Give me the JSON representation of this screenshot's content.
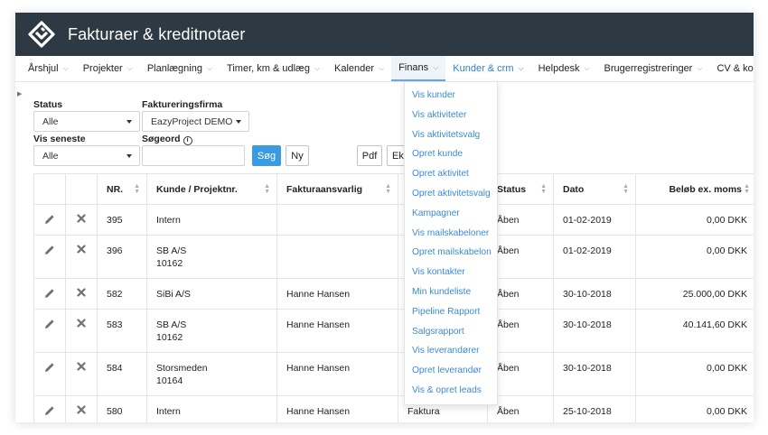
{
  "app": {
    "title": "Fakturaer & kreditnotaer"
  },
  "nav": {
    "items": [
      {
        "label": "Årshjul",
        "id": "arshjul"
      },
      {
        "label": "Projekter",
        "id": "projekter"
      },
      {
        "label": "Planlægning",
        "id": "planlaegning"
      },
      {
        "label": "Timer, km & udlæg",
        "id": "timer"
      },
      {
        "label": "Kalender",
        "id": "kalender"
      },
      {
        "label": "Finans",
        "id": "finans"
      },
      {
        "label": "Kunder & crm",
        "id": "kunder"
      },
      {
        "label": "Helpdesk",
        "id": "helpdesk"
      },
      {
        "label": "Brugerregistreringer",
        "id": "brugerregistreringer"
      },
      {
        "label": "CV & kompetencer",
        "id": "cv"
      },
      {
        "label": "K",
        "id": "k"
      }
    ],
    "active": "finans",
    "open": "kunder"
  },
  "dropdown": {
    "items": [
      "Vis kunder",
      "Vis aktiviteter",
      "Vis aktivitetsvalg",
      "Opret kunde",
      "Opret aktivitet",
      "Opret aktivitetsvalg",
      "Kampagner",
      "Vis mailskabeloner",
      "Opret mailskabelon",
      "Vis kontakter",
      "Min kundeliste",
      "Pipeline Rapport",
      "Salgsrapport",
      "Vis leverandører",
      "Opret leverandør",
      "Vis & opret leads"
    ]
  },
  "filters": {
    "status_label": "Status",
    "status_value": "Alle",
    "firm_label": "Faktureringsfirma",
    "firm_value": "EazyProject DEMO",
    "recent_label": "Vis seneste",
    "recent_value": "Alle",
    "search_label": "Søgeord",
    "search_value": "",
    "search_button": "Søg",
    "new_button": "Ny",
    "pdf_button": "Pdf",
    "export_button": "Ek"
  },
  "table": {
    "headers": [
      "",
      "",
      "NR.",
      "Kunde / Projektnr.",
      "Fakturaansvarlig",
      "",
      "Status",
      "Dato",
      "Beløb ex. moms"
    ],
    "rows": [
      {
        "nr": "395",
        "kunde": "Intern",
        "projekt": "",
        "ansvarlig": "",
        "type": "",
        "status": "Åben",
        "dato": "01-02-2019",
        "belob": "0,00 DKK"
      },
      {
        "nr": "396",
        "kunde": "SB A/S",
        "projekt": "10162",
        "ansvarlig": "",
        "type": "",
        "status": "Åben",
        "dato": "01-02-2019",
        "belob": "0,00 DKK"
      },
      {
        "nr": "582",
        "kunde": "SiBi A/S",
        "projekt": "",
        "ansvarlig": "Hanne Hansen",
        "type": "",
        "status": "Åben",
        "dato": "30-10-2018",
        "belob": "25.000,00 DKK"
      },
      {
        "nr": "583",
        "kunde": "SB A/S",
        "projekt": "10162",
        "ansvarlig": "Hanne Hansen",
        "type": "",
        "status": "Åben",
        "dato": "30-10-2018",
        "belob": "40.141,60 DKK"
      },
      {
        "nr": "584",
        "kunde": "Storsmeden",
        "projekt": "10164",
        "ansvarlig": "Hanne Hansen",
        "type": "",
        "status": "Åben",
        "dato": "30-10-2018",
        "belob": "0,00 DKK"
      },
      {
        "nr": "580",
        "kunde": "Intern",
        "projekt": "",
        "ansvarlig": "Hanne Hansen",
        "type": "Faktura",
        "status": "Åben",
        "dato": "25-10-2018",
        "belob": "0,00 DKK"
      }
    ]
  },
  "colors": {
    "topbar": "#2d3a43",
    "accent": "#3b9be0",
    "link": "#3a8ad4"
  }
}
